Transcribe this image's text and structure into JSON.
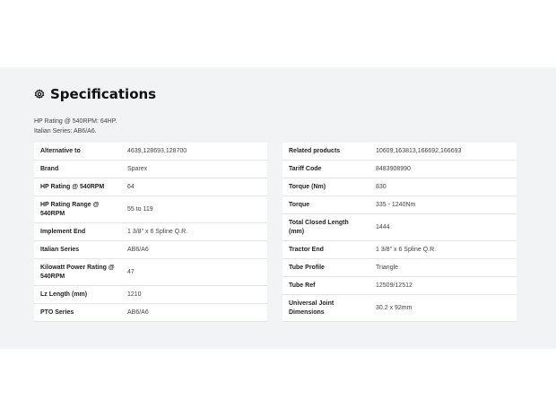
{
  "section": {
    "title": "Specifications",
    "icon": "gear-icon",
    "intro": [
      "HP Rating @ 540RPM: 64HP.",
      "Italian Series: AB6/A6."
    ]
  },
  "left_table": [
    {
      "label": "Alternative to",
      "value": "4639,128693,128700"
    },
    {
      "label": "Brand",
      "value": "Sparex"
    },
    {
      "label": "HP Rating @ 540RPM",
      "value": "64"
    },
    {
      "label": "HP Rating Range @ 540RPM",
      "value": "55 to 119"
    },
    {
      "label": "Implement End",
      "value": "1 3/8\" x 6 Spline Q.R."
    },
    {
      "label": "Italian Series",
      "value": "AB6/A6"
    },
    {
      "label": "Kilowatt Power Rating @ 540RPM",
      "value": "47"
    },
    {
      "label": "Lz Length (mm)",
      "value": "1210"
    },
    {
      "label": "PTO Series",
      "value": "AB6/A6"
    }
  ],
  "right_table": [
    {
      "label": "Related products",
      "value": "10609,163813,166692,166693"
    },
    {
      "label": "Tariff Code",
      "value": "8483908990"
    },
    {
      "label": "Torque (Nm)",
      "value": "830"
    },
    {
      "label": "Torque",
      "value": "335 - 1240Nm"
    },
    {
      "label": "Total Closed Length (mm)",
      "value": "1444"
    },
    {
      "label": "Tractor End",
      "value": "1 3/8\" x 6 Spline Q.R."
    },
    {
      "label": "Tube Profile",
      "value": "Triangle"
    },
    {
      "label": "Tube Ref",
      "value": "12509/12512"
    },
    {
      "label": "Universal Joint Dimensions",
      "value": "30.2 x 92mm"
    }
  ]
}
